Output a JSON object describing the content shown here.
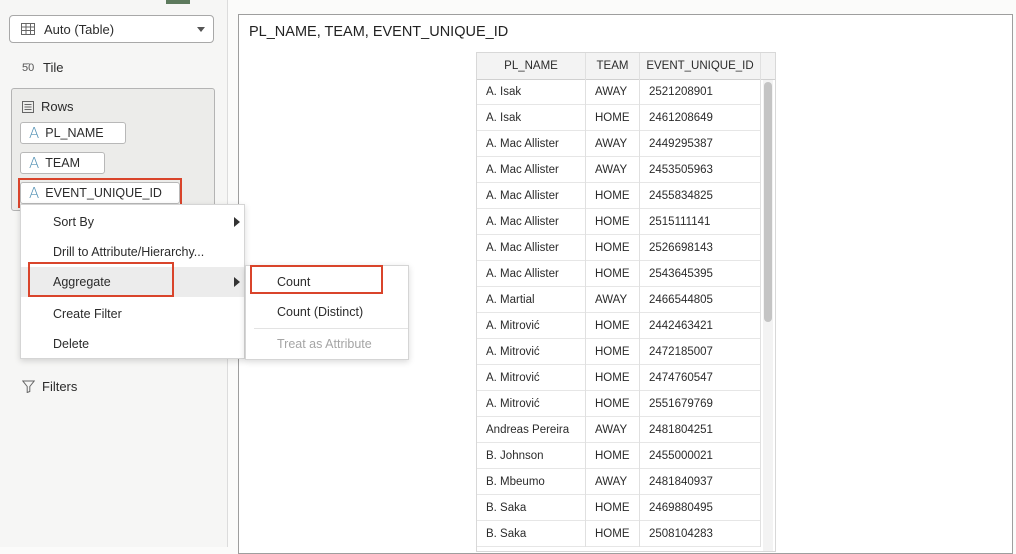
{
  "viz_type": {
    "label": "Auto (Table)"
  },
  "tile": {
    "icon": "5̄0",
    "label": "Tile"
  },
  "rows": {
    "label": "Rows",
    "pills": [
      "PL_NAME",
      "TEAM",
      "EVENT_UNIQUE_ID"
    ],
    "pill_icon": "A"
  },
  "context_menu": {
    "items": [
      "Sort By",
      "Drill to Attribute/Hierarchy...",
      "Aggregate",
      "Create Filter",
      "Delete"
    ]
  },
  "aggregate_submenu": {
    "items": [
      "Count",
      "Count (Distinct)",
      "Treat as Attribute"
    ]
  },
  "filters": {
    "label": "Filters"
  },
  "visualization": {
    "title": "PL_NAME, TEAM, EVENT_UNIQUE_ID",
    "columns": [
      "PL_NAME",
      "TEAM",
      "EVENT_UNIQUE_ID"
    ],
    "rows": [
      [
        "A. Isak",
        "AWAY",
        "2521208901"
      ],
      [
        "A. Isak",
        "HOME",
        "2461208649"
      ],
      [
        "A. Mac Allister",
        "AWAY",
        "2449295387"
      ],
      [
        "A. Mac Allister",
        "AWAY",
        "2453505963"
      ],
      [
        "A. Mac Allister",
        "HOME",
        "2455834825"
      ],
      [
        "A. Mac Allister",
        "HOME",
        "2515111141"
      ],
      [
        "A. Mac Allister",
        "HOME",
        "2526698143"
      ],
      [
        "A. Mac Allister",
        "HOME",
        "2543645395"
      ],
      [
        "A. Martial",
        "AWAY",
        "2466544805"
      ],
      [
        "A. Mitrović",
        "HOME",
        "2442463421"
      ],
      [
        "A. Mitrović",
        "HOME",
        "2472185007"
      ],
      [
        "A. Mitrović",
        "HOME",
        "2474760547"
      ],
      [
        "A. Mitrović",
        "HOME",
        "2551679769"
      ],
      [
        "Andreas Pereira",
        "AWAY",
        "2481804251"
      ],
      [
        "B. Johnson",
        "HOME",
        "2455000021"
      ],
      [
        "B. Mbeumo",
        "AWAY",
        "2481840937"
      ],
      [
        "B. Saka",
        "HOME",
        "2469880495"
      ],
      [
        "B. Saka",
        "HOME",
        "2508104283"
      ]
    ]
  },
  "colors": {
    "highlight": "#d9442b",
    "attribute_icon": "#4f8fb3"
  }
}
